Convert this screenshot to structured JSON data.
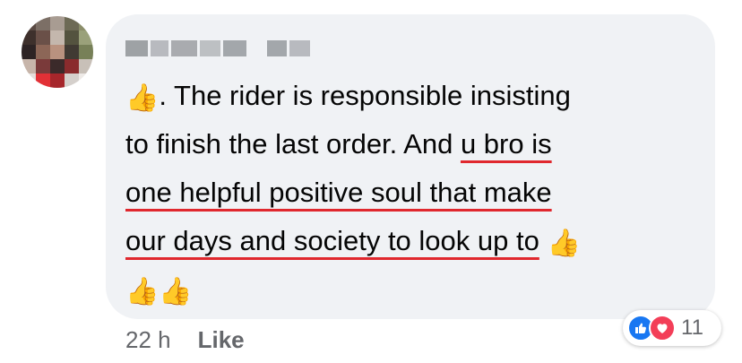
{
  "comment": {
    "author_name": "",
    "lines": [
      {
        "prefix_emoji": "👍",
        "text": ". The rider is responsible insisting",
        "underlined": ""
      },
      {
        "text": "to finish the last order. And ",
        "underlined": "u bro is"
      },
      {
        "text": "",
        "underlined": "one helpful positive soul that make"
      },
      {
        "text": "",
        "underlined": "our days and society to look up to",
        "suffix_emoji": "👍"
      },
      {
        "emoji_only": "👍👍"
      }
    ]
  },
  "meta": {
    "time": "22 h",
    "like_label": "Like"
  },
  "reactions": {
    "icons": [
      "like-icon",
      "love-icon"
    ],
    "count": "11",
    "colors": {
      "like": "#1877f2",
      "love": "#f33e58"
    }
  },
  "colors": {
    "bubble": "#f0f2f5",
    "underline": "#e0282e",
    "meta_text": "#65676b"
  }
}
